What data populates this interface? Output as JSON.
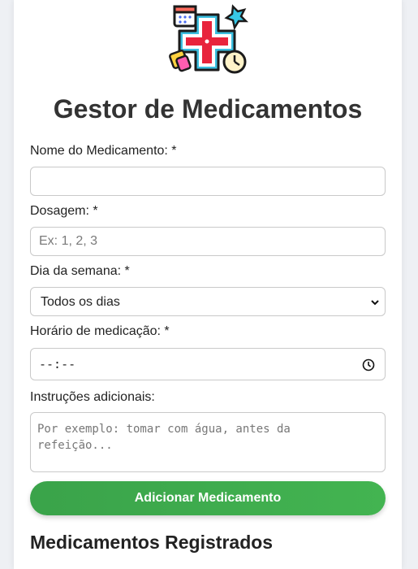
{
  "app": {
    "title": "Gestor de Medicamentos",
    "logo_icon": "medical-cross-icon"
  },
  "form": {
    "name": {
      "label": "Nome do Medicamento: *",
      "value": "",
      "placeholder": ""
    },
    "dosage": {
      "label": "Dosagem: *",
      "value": "",
      "placeholder": "Ex: 1, 2, 3"
    },
    "weekday": {
      "label": "Dia da semana: *",
      "selected": "Todos os dias"
    },
    "time": {
      "label": "Horário de medicação: *",
      "value": "--:--",
      "icon": "clock-icon"
    },
    "notes": {
      "label": "Instruções adicionais:",
      "placeholder": "Por exemplo: tomar com água, antes da refeição..."
    },
    "submit_label": "Adicionar Medicamento"
  },
  "registered": {
    "heading": "Medicamentos Registrados"
  },
  "colors": {
    "button": "#3aa34a",
    "cross": "#e8243c",
    "text": "#333333"
  }
}
